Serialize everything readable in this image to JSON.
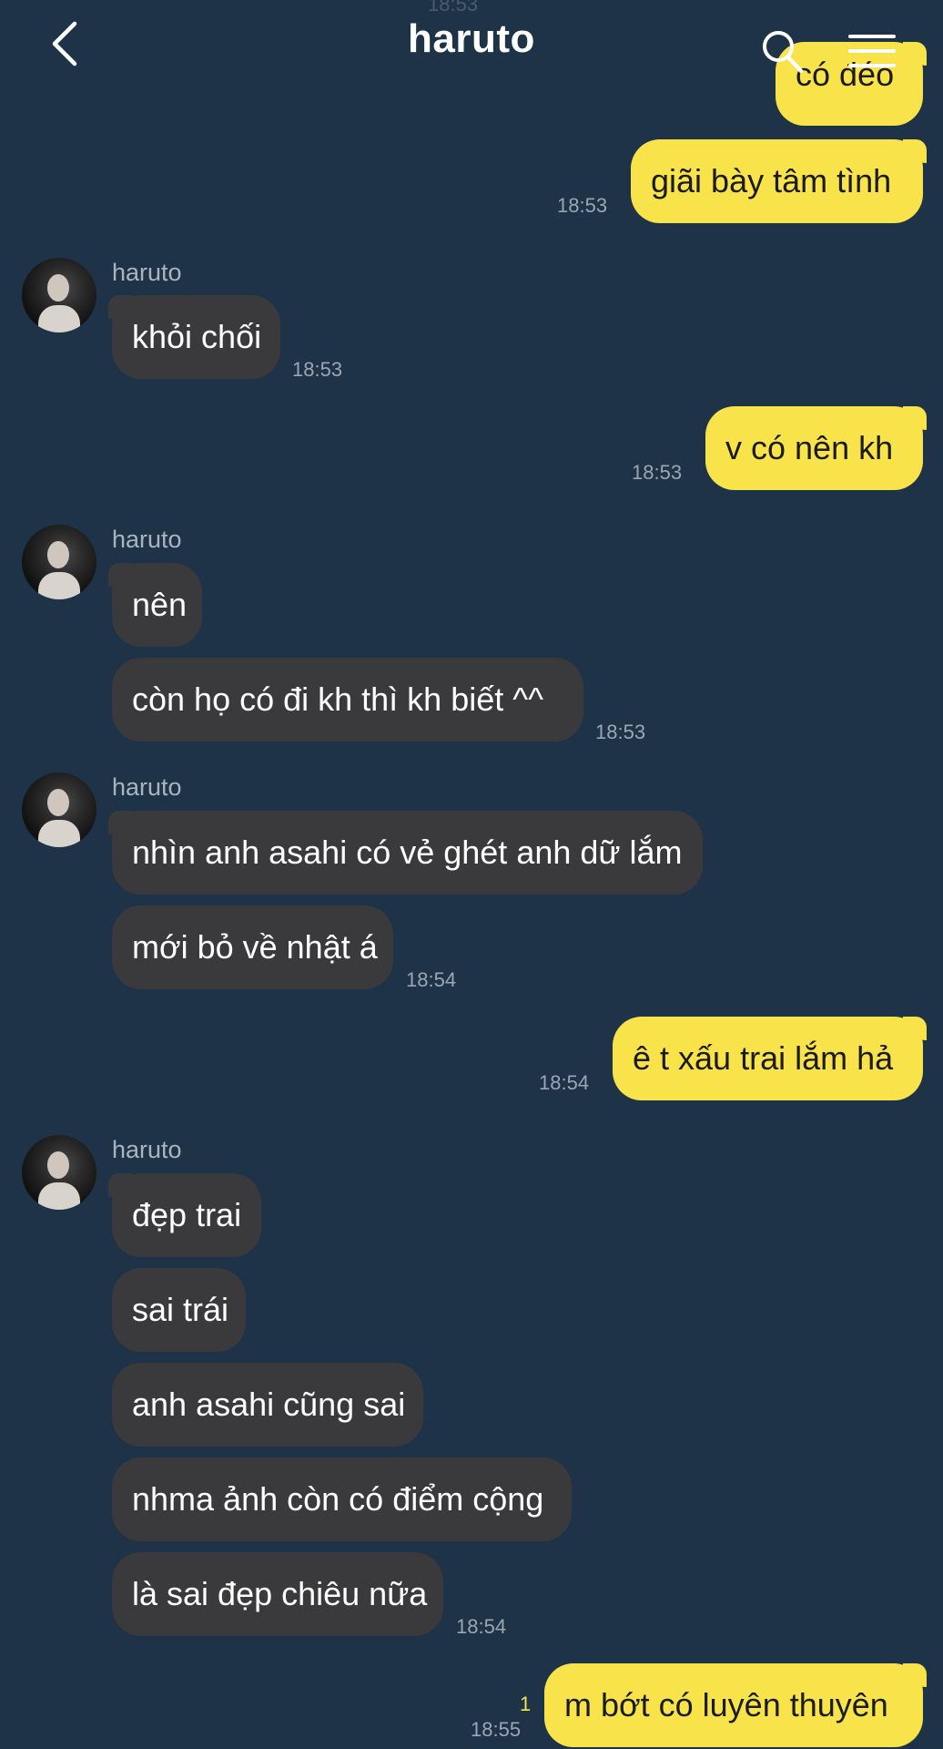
{
  "header": {
    "title": "haruto"
  },
  "top_partial_time": "18:53",
  "messages": {
    "m0_text": "có đéo",
    "m1_text": "giãi bày tâm tình",
    "m1_time": "18:53",
    "s1_sender": "haruto",
    "m2_text": "khỏi chối",
    "m2_time": "18:53",
    "m3_text": "v có nên kh",
    "m3_time": "18:53",
    "s2_sender": "haruto",
    "m4_text": "nên",
    "m5_text": "còn họ có đi kh thì kh biết ^^",
    "m5_time": "18:53",
    "s3_sender": "haruto",
    "m6_text": "nhìn anh asahi có vẻ ghét anh dữ lắm",
    "m7_text": "mới bỏ về nhật á",
    "m7_time": "18:54",
    "m8_text": "ê t xấu trai lắm hả",
    "m8_time": "18:54",
    "s4_sender": "haruto",
    "m9_text": "đẹp trai",
    "m10_text": "sai trái",
    "m11_text": "anh asahi cũng sai",
    "m12_text": "nhma ảnh còn có điểm cộng",
    "m13_text": "là sai đẹp chiêu nữa",
    "m13_time": "18:54",
    "m14_text": "m bớt có luyên thuyên",
    "m14_read": "1",
    "m14_time": "18:55"
  },
  "icons": {
    "back": "chevron-left-icon",
    "search": "search-icon",
    "menu": "hamburger-menu-icon"
  },
  "colors": {
    "background": "#1e3347",
    "incoming_bubble": "#3a3a3c",
    "outgoing_bubble": "#f8e44a"
  }
}
